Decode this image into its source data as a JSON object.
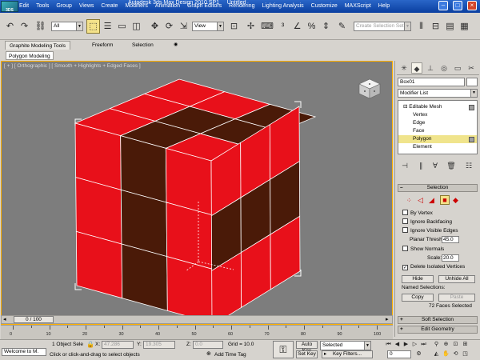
{
  "window": {
    "app_title": "Autodesk 3ds Max Design 2010 SP1",
    "doc_title": "Untitled",
    "app_icon_label": "3DS"
  },
  "menu": [
    "Edit",
    "Tools",
    "Group",
    "Views",
    "Create",
    "Modifiers",
    "Animation",
    "Graph Editors",
    "Rendering",
    "Lighting Analysis",
    "Customize",
    "MAXScript",
    "Help"
  ],
  "toolbar": {
    "selection_filter": "All",
    "reference_coord": "View",
    "named_selection_placeholder": "Create Selection Set"
  },
  "ribbon": {
    "tabs": [
      "Graphite Modeling Tools",
      "Freeform",
      "Selection"
    ],
    "active_tab": "Graphite Modeling Tools",
    "sub_label": "Polygon Modeling"
  },
  "viewport": {
    "label": "[ + ] [ Orthographic ] [ Smooth + Highlights + Edged Faces ]",
    "cube_colors": {
      "red": "#e8101a",
      "dark": "#4a1a08",
      "edge": "#ffffff"
    }
  },
  "command_panel": {
    "object_name": "Box01",
    "modifier_list": "Modifier List",
    "stack": [
      {
        "label": "Editable Mesh",
        "level": 0,
        "selected": false
      },
      {
        "label": "Vertex",
        "level": 1,
        "selected": false
      },
      {
        "label": "Edge",
        "level": 1,
        "selected": false
      },
      {
        "label": "Face",
        "level": 1,
        "selected": false
      },
      {
        "label": "Polygon",
        "level": 1,
        "selected": true
      },
      {
        "label": "Element",
        "level": 1,
        "selected": false
      }
    ],
    "selection_rollout": {
      "title": "Selection",
      "by_vertex": "By Vertex",
      "ignore_backfacing": "Ignore Backfacing",
      "ignore_visible_edges": "Ignore Visible Edges",
      "planar_thresh_label": "Planar Thresh:",
      "planar_thresh_value": "45.0",
      "show_normals": "Show Normals",
      "scale_label": "Scale:",
      "scale_value": "20.0",
      "delete_isolated": "Delete Isolated Vertices",
      "hide": "Hide",
      "unhide_all": "Unhide All",
      "named_selections": "Named Selections:",
      "copy": "Copy",
      "paste": "Paste",
      "status": "72 Faces Selected"
    },
    "soft_selection": "Soft Selection",
    "edit_geometry": "Edit Geometry"
  },
  "timeline": {
    "frame_display": "0 / 100",
    "ticks": [
      "0",
      "10",
      "20",
      "30",
      "40",
      "50",
      "60",
      "70",
      "80",
      "90",
      "100"
    ]
  },
  "status": {
    "maxscript": "Welcome to M.",
    "selected_count": "1 Object Sele",
    "x_label": "X:",
    "x_value": "47.286",
    "y_label": "Y:",
    "y_value": "19.305",
    "z_label": "Z:",
    "z_value": "0.0",
    "grid": "Grid = 10.0",
    "prompt": "Click or click-and-drag to select objects",
    "add_time_tag": "Add Time Tag",
    "auto_key": "Auto Key",
    "set_key": "Set Key",
    "selected": "Selected",
    "key_filters": "Key Filters...",
    "frame": "0"
  }
}
